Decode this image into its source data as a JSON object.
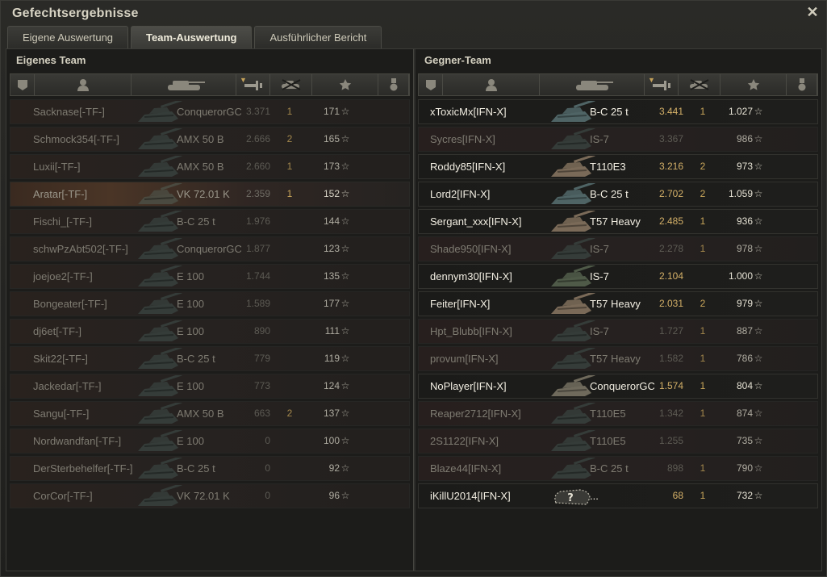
{
  "window": {
    "title": "Gefechtsergebnisse",
    "close_icon": "close-icon"
  },
  "tabs": [
    {
      "label": "Eigene Auswertung",
      "active": false
    },
    {
      "label": "Team-Auswertung",
      "active": true
    },
    {
      "label": "Ausführlicher Bericht",
      "active": false
    }
  ],
  "columns": {
    "squad": "squad-icon",
    "player": "player-icon",
    "vehicle": "tank-icon",
    "damage": "damage-icon",
    "kills": "kills-icon",
    "xp": "star-icon",
    "medals": "medal-icon"
  },
  "own_team": {
    "title": "Eigenes Team",
    "rows": [
      {
        "name": "Sacknase[-TF-]",
        "tank": "ConquerorGC",
        "damage": "3.371",
        "kills": "1",
        "xp": "171",
        "state": "dead"
      },
      {
        "name": "Schmock354[-TF-]",
        "tank": "AMX 50 B",
        "damage": "2.666",
        "kills": "2",
        "xp": "165",
        "state": "dead"
      },
      {
        "name": "Luxii[-TF-]",
        "tank": "AMX 50 B",
        "damage": "2.660",
        "kills": "1",
        "xp": "173",
        "state": "dead"
      },
      {
        "name": "Aratar[-TF-]",
        "tank": "VK 72.01 K",
        "damage": "2.359",
        "kills": "1",
        "xp": "152",
        "state": "highlight"
      },
      {
        "name": "Fischi_[-TF-]",
        "tank": "B-C 25 t",
        "damage": "1.976",
        "kills": "",
        "xp": "144",
        "state": "dead"
      },
      {
        "name": "schwPzAbt502[-TF-]",
        "tank": "ConquerorGC",
        "damage": "1.877",
        "kills": "",
        "xp": "123",
        "state": "dead"
      },
      {
        "name": "joejoe2[-TF-]",
        "tank": "E 100",
        "damage": "1.744",
        "kills": "",
        "xp": "135",
        "state": "dead"
      },
      {
        "name": "Bongeater[-TF-]",
        "tank": "E 100",
        "damage": "1.589",
        "kills": "",
        "xp": "177",
        "state": "dead"
      },
      {
        "name": "dj6et[-TF-]",
        "tank": "E 100",
        "damage": "890",
        "kills": "",
        "xp": "111",
        "state": "dead"
      },
      {
        "name": "Skit22[-TF-]",
        "tank": "B-C 25 t",
        "damage": "779",
        "kills": "",
        "xp": "119",
        "state": "dead"
      },
      {
        "name": "Jackedar[-TF-]",
        "tank": "E 100",
        "damage": "773",
        "kills": "",
        "xp": "124",
        "state": "dead"
      },
      {
        "name": "Sangu[-TF-]",
        "tank": "AMX 50 B",
        "damage": "663",
        "kills": "2",
        "xp": "137",
        "state": "dead"
      },
      {
        "name": "Nordwandfan[-TF-]",
        "tank": "E 100",
        "damage": "0",
        "kills": "",
        "xp": "100",
        "state": "dead"
      },
      {
        "name": "DerSterbehelfer[-TF-]",
        "tank": "B-C 25 t",
        "damage": "0",
        "kills": "",
        "xp": "92",
        "state": "dead"
      },
      {
        "name": "CorCor[-TF-]",
        "tank": "VK 72.01 K",
        "damage": "0",
        "kills": "",
        "xp": "96",
        "state": "dead"
      }
    ]
  },
  "enemy_team": {
    "title": "Gegner-Team",
    "rows": [
      {
        "name": "xToxicMx[IFN-X]",
        "tank": "B-C 25 t",
        "damage": "3.441",
        "kills": "1",
        "xp": "1.027",
        "state": "alive"
      },
      {
        "name": "Sycres[IFN-X]",
        "tank": "IS-7",
        "damage": "3.367",
        "kills": "",
        "xp": "986",
        "state": "dead"
      },
      {
        "name": "Roddy85[IFN-X]",
        "tank": "T110E3",
        "damage": "3.216",
        "kills": "2",
        "xp": "973",
        "state": "alive"
      },
      {
        "name": "Lord2[IFN-X]",
        "tank": "B-C 25 t",
        "damage": "2.702",
        "kills": "2",
        "xp": "1.059",
        "state": "alive"
      },
      {
        "name": "Sergant_xxx[IFN-X]",
        "tank": "T57 Heavy",
        "damage": "2.485",
        "kills": "1",
        "xp": "936",
        "state": "alive"
      },
      {
        "name": "Shade950[IFN-X]",
        "tank": "IS-7",
        "damage": "2.278",
        "kills": "1",
        "xp": "978",
        "state": "dead"
      },
      {
        "name": "dennym30[IFN-X]",
        "tank": "IS-7",
        "damage": "2.104",
        "kills": "",
        "xp": "1.000",
        "state": "alive"
      },
      {
        "name": "Feiter[IFN-X]",
        "tank": "T57 Heavy",
        "damage": "2.031",
        "kills": "2",
        "xp": "979",
        "state": "alive"
      },
      {
        "name": "Hpt_Blubb[IFN-X]",
        "tank": "IS-7",
        "damage": "1.727",
        "kills": "1",
        "xp": "887",
        "state": "dead"
      },
      {
        "name": "provum[IFN-X]",
        "tank": "T57 Heavy",
        "damage": "1.582",
        "kills": "1",
        "xp": "786",
        "state": "dead"
      },
      {
        "name": "NoPlayer[IFN-X]",
        "tank": "ConquerorGC",
        "damage": "1.574",
        "kills": "1",
        "xp": "804",
        "state": "alive"
      },
      {
        "name": "Reaper2712[IFN-X]",
        "tank": "T110E5",
        "damage": "1.342",
        "kills": "1",
        "xp": "874",
        "state": "dead"
      },
      {
        "name": "2S1122[IFN-X]",
        "tank": "T110E5",
        "damage": "1.255",
        "kills": "",
        "xp": "735",
        "state": "dead"
      },
      {
        "name": "Blaze44[IFN-X]",
        "tank": "B-C 25 t",
        "damage": "898",
        "kills": "1",
        "xp": "790",
        "state": "dead"
      },
      {
        "name": "iKillU2014[IFN-X]",
        "tank": "...",
        "damage": "68",
        "kills": "1",
        "xp": "732",
        "state": "unknown"
      }
    ]
  },
  "star_glyph": "☆",
  "unknown_glyph": "?"
}
